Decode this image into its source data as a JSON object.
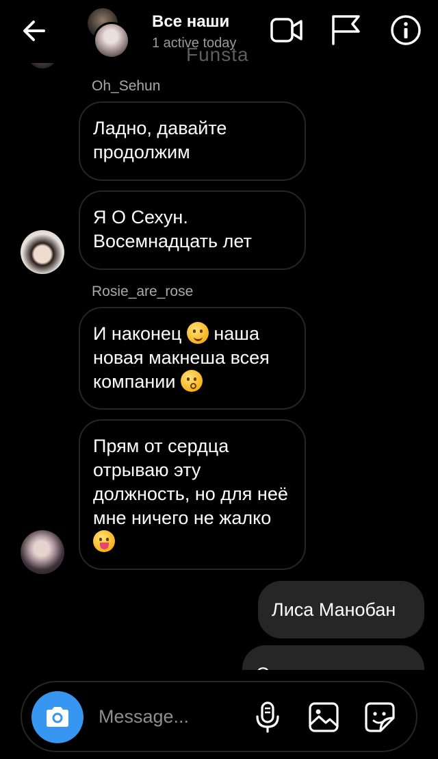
{
  "header": {
    "title": "Все наши",
    "subtitle": "1 active today",
    "watermark": "Funsta",
    "icons": [
      "back-arrow-icon",
      "video-call-icon",
      "flag-icon",
      "info-icon"
    ]
  },
  "messages": {
    "sehun_sender": "Oh_Sehun",
    "sehun_msg1": "Ладно, давайте продолжим",
    "sehun_msg2_line1": "Я О Сехун.",
    "sehun_msg2_line2": "Восемнадцать лет",
    "rosie_sender": "Rosie_are_rose",
    "rosie_msg1_part1": "И наконец ",
    "rosie_msg1_part2": " наша новая макнеша всея компании ",
    "rosie_msg2": "Прям от сердца отрываю эту должность, но для неё мне ничего не жалко",
    "out_msg1": "Лиса Манобан",
    "out_msg2_partial": "Семнадцать лет"
  },
  "composer": {
    "placeholder": "Message...",
    "icons": [
      "camera-icon",
      "microphone-icon",
      "gallery-icon",
      "sticker-icon"
    ]
  },
  "colors": {
    "background": "#000000",
    "bubble_out": "#262626",
    "bubble_border": "#262626",
    "camera_button": "#3797f0",
    "sender_text": "#a8a8a8"
  }
}
